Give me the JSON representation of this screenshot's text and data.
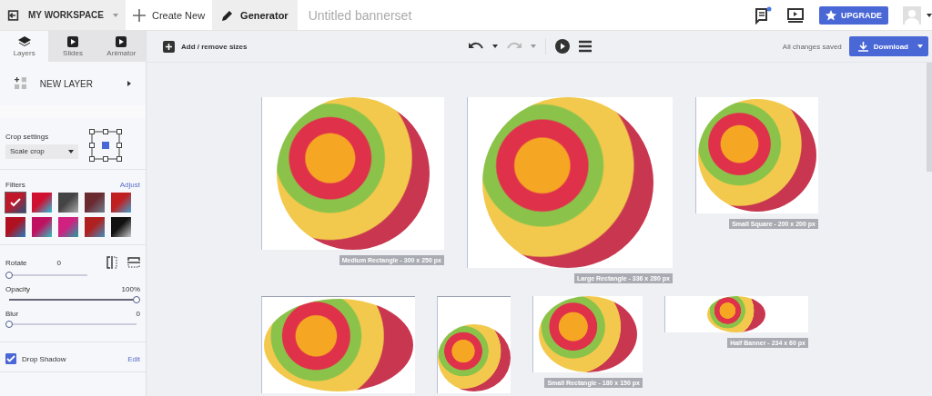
{
  "topbar": {
    "workspace": "MY WORKSPACE",
    "create_new": "Create New",
    "generator": "Generator",
    "title": "Untitled bannerset",
    "notification": true,
    "upgrade": "UPGRADE"
  },
  "sidebar": {
    "tabs": [
      {
        "label": "Layers",
        "selected": true
      },
      {
        "label": "Slides",
        "selected": false
      },
      {
        "label": "Animator",
        "selected": false
      }
    ],
    "new_layer": "NEW LAYER",
    "crop": {
      "label": "Crop settings",
      "value": "Scale crop"
    },
    "filters": {
      "label": "Filters",
      "adjust": "Adjust",
      "items": [
        {
          "selected": true
        },
        {
          "selected": false
        },
        {
          "selected": false
        },
        {
          "selected": false
        },
        {
          "selected": false
        },
        {
          "selected": false
        },
        {
          "selected": false
        },
        {
          "selected": false
        },
        {
          "selected": false
        },
        {
          "selected": false
        }
      ]
    },
    "rotate": {
      "label": "Rotate",
      "reading": "0",
      "level": 0
    },
    "opacity": {
      "label": "Opacity",
      "reading": "100%",
      "level": 1
    },
    "blur": {
      "label": "Blur",
      "reading": "0",
      "level": 0
    },
    "drop_shadow": {
      "label": "Drop Shadow",
      "checked": true,
      "edit": "Edit"
    }
  },
  "toolbar": {
    "add_remove": "Add / remove sizes",
    "status": "All changes saved",
    "download": "Download"
  },
  "banners": [
    {
      "label": "Medium Rectangle - 300 x 250 px"
    },
    {
      "label": "Large Rectangle - 336 x 280 px"
    },
    {
      "label": "Small Square - 200 x 200 px"
    },
    {
      "kind": "cropped"
    },
    {
      "kind": "cropped"
    },
    {
      "label": "Small Rectangle - 180 x 150 px"
    },
    {
      "label": "Half Banner - 234 x 60 px"
    }
  ]
}
